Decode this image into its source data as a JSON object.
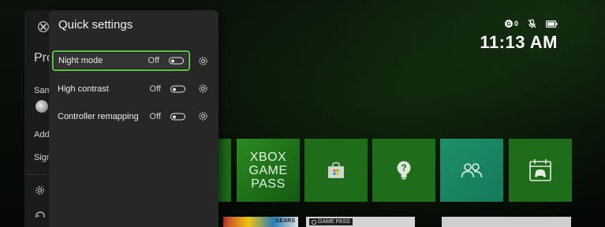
{
  "status": {
    "badge_text": "0",
    "icons": [
      "g-badge-icon",
      "mic-muted-icon",
      "battery-icon"
    ]
  },
  "clock": {
    "time": "11:13 AM"
  },
  "guide": {
    "title": "Pro",
    "gamertag": "Sam",
    "add_label": "Add",
    "sign_label": "Sign"
  },
  "quick_settings": {
    "title": "Quick settings",
    "items": [
      {
        "label": "Night mode",
        "state": "Off",
        "focused": true
      },
      {
        "label": "High contrast",
        "state": "Off",
        "focused": false
      },
      {
        "label": "Controller remapping",
        "state": "Off",
        "focused": false
      }
    ]
  },
  "tiles": {
    "gamepass_lines": [
      "XBOX",
      "GAME",
      "PASS"
    ],
    "icons": [
      "store-icon",
      "tips-icon",
      "friends-icon",
      "events-icon"
    ]
  },
  "row2": {
    "a_text": "GEARS",
    "b_badge": "GAME PASS"
  },
  "colors": {
    "accent": "#5fc34a",
    "tile_green": "#1f6c1b",
    "panel_bg": "#272727"
  }
}
